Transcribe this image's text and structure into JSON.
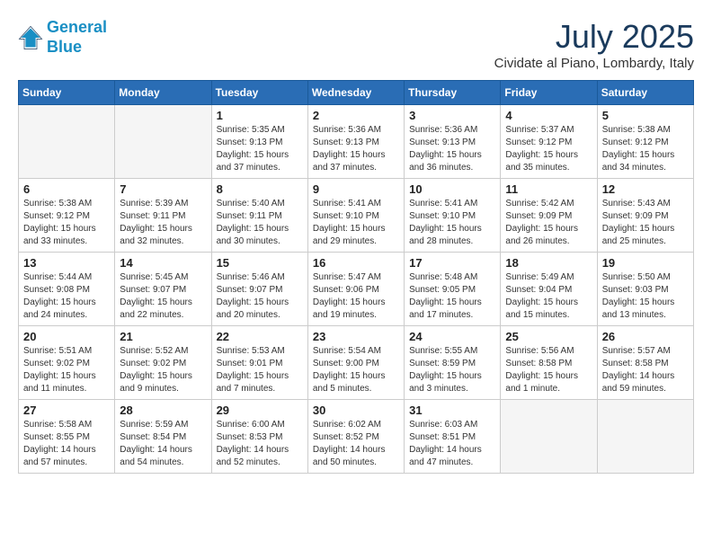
{
  "logo": {
    "line1": "General",
    "line2": "Blue"
  },
  "title": "July 2025",
  "subtitle": "Cividate al Piano, Lombardy, Italy",
  "days_of_week": [
    "Sunday",
    "Monday",
    "Tuesday",
    "Wednesday",
    "Thursday",
    "Friday",
    "Saturday"
  ],
  "weeks": [
    [
      {
        "day": "",
        "empty": true
      },
      {
        "day": "",
        "empty": true
      },
      {
        "day": "1",
        "sunrise": "5:35 AM",
        "sunset": "9:13 PM",
        "daylight": "15 hours and 37 minutes."
      },
      {
        "day": "2",
        "sunrise": "5:36 AM",
        "sunset": "9:13 PM",
        "daylight": "15 hours and 37 minutes."
      },
      {
        "day": "3",
        "sunrise": "5:36 AM",
        "sunset": "9:13 PM",
        "daylight": "15 hours and 36 minutes."
      },
      {
        "day": "4",
        "sunrise": "5:37 AM",
        "sunset": "9:12 PM",
        "daylight": "15 hours and 35 minutes."
      },
      {
        "day": "5",
        "sunrise": "5:38 AM",
        "sunset": "9:12 PM",
        "daylight": "15 hours and 34 minutes."
      }
    ],
    [
      {
        "day": "6",
        "sunrise": "5:38 AM",
        "sunset": "9:12 PM",
        "daylight": "15 hours and 33 minutes."
      },
      {
        "day": "7",
        "sunrise": "5:39 AM",
        "sunset": "9:11 PM",
        "daylight": "15 hours and 32 minutes."
      },
      {
        "day": "8",
        "sunrise": "5:40 AM",
        "sunset": "9:11 PM",
        "daylight": "15 hours and 30 minutes."
      },
      {
        "day": "9",
        "sunrise": "5:41 AM",
        "sunset": "9:10 PM",
        "daylight": "15 hours and 29 minutes."
      },
      {
        "day": "10",
        "sunrise": "5:41 AM",
        "sunset": "9:10 PM",
        "daylight": "15 hours and 28 minutes."
      },
      {
        "day": "11",
        "sunrise": "5:42 AM",
        "sunset": "9:09 PM",
        "daylight": "15 hours and 26 minutes."
      },
      {
        "day": "12",
        "sunrise": "5:43 AM",
        "sunset": "9:09 PM",
        "daylight": "15 hours and 25 minutes."
      }
    ],
    [
      {
        "day": "13",
        "sunrise": "5:44 AM",
        "sunset": "9:08 PM",
        "daylight": "15 hours and 24 minutes."
      },
      {
        "day": "14",
        "sunrise": "5:45 AM",
        "sunset": "9:07 PM",
        "daylight": "15 hours and 22 minutes."
      },
      {
        "day": "15",
        "sunrise": "5:46 AM",
        "sunset": "9:07 PM",
        "daylight": "15 hours and 20 minutes."
      },
      {
        "day": "16",
        "sunrise": "5:47 AM",
        "sunset": "9:06 PM",
        "daylight": "15 hours and 19 minutes."
      },
      {
        "day": "17",
        "sunrise": "5:48 AM",
        "sunset": "9:05 PM",
        "daylight": "15 hours and 17 minutes."
      },
      {
        "day": "18",
        "sunrise": "5:49 AM",
        "sunset": "9:04 PM",
        "daylight": "15 hours and 15 minutes."
      },
      {
        "day": "19",
        "sunrise": "5:50 AM",
        "sunset": "9:03 PM",
        "daylight": "15 hours and 13 minutes."
      }
    ],
    [
      {
        "day": "20",
        "sunrise": "5:51 AM",
        "sunset": "9:02 PM",
        "daylight": "15 hours and 11 minutes."
      },
      {
        "day": "21",
        "sunrise": "5:52 AM",
        "sunset": "9:02 PM",
        "daylight": "15 hours and 9 minutes."
      },
      {
        "day": "22",
        "sunrise": "5:53 AM",
        "sunset": "9:01 PM",
        "daylight": "15 hours and 7 minutes."
      },
      {
        "day": "23",
        "sunrise": "5:54 AM",
        "sunset": "9:00 PM",
        "daylight": "15 hours and 5 minutes."
      },
      {
        "day": "24",
        "sunrise": "5:55 AM",
        "sunset": "8:59 PM",
        "daylight": "15 hours and 3 minutes."
      },
      {
        "day": "25",
        "sunrise": "5:56 AM",
        "sunset": "8:58 PM",
        "daylight": "15 hours and 1 minute."
      },
      {
        "day": "26",
        "sunrise": "5:57 AM",
        "sunset": "8:58 PM",
        "daylight": "14 hours and 59 minutes."
      }
    ],
    [
      {
        "day": "27",
        "sunrise": "5:58 AM",
        "sunset": "8:55 PM",
        "daylight": "14 hours and 57 minutes."
      },
      {
        "day": "28",
        "sunrise": "5:59 AM",
        "sunset": "8:54 PM",
        "daylight": "14 hours and 54 minutes."
      },
      {
        "day": "29",
        "sunrise": "6:00 AM",
        "sunset": "8:53 PM",
        "daylight": "14 hours and 52 minutes."
      },
      {
        "day": "30",
        "sunrise": "6:02 AM",
        "sunset": "8:52 PM",
        "daylight": "14 hours and 50 minutes."
      },
      {
        "day": "31",
        "sunrise": "6:03 AM",
        "sunset": "8:51 PM",
        "daylight": "14 hours and 47 minutes."
      },
      {
        "day": "",
        "empty": true
      },
      {
        "day": "",
        "empty": true
      }
    ]
  ]
}
